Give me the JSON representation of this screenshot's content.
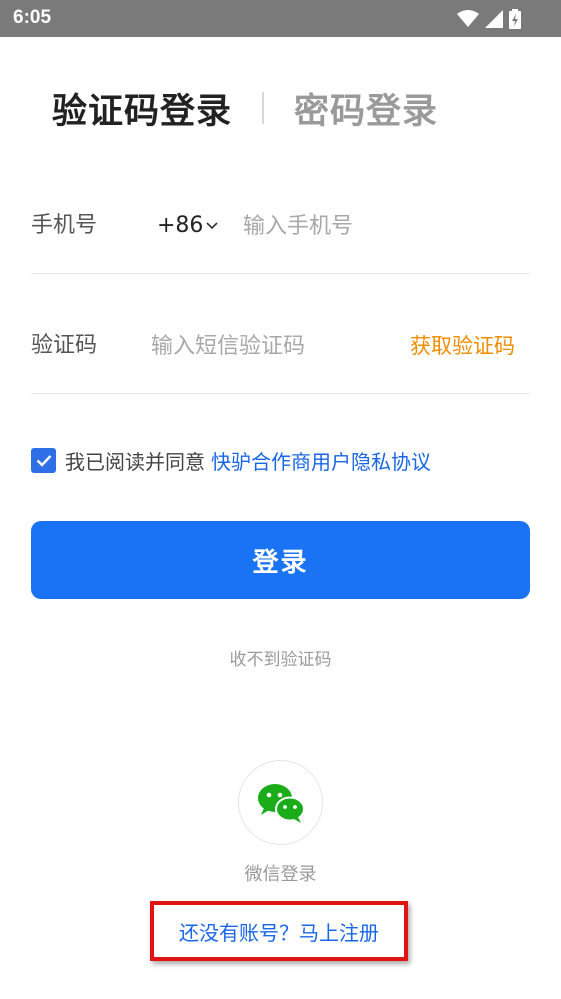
{
  "status_bar": {
    "time": "6:05",
    "icons": [
      "wifi-icon",
      "signal-icon",
      "battery-charging-icon"
    ]
  },
  "tabs": {
    "active": "验证码登录",
    "inactive": "密码登录"
  },
  "phone": {
    "label": "手机号",
    "country_code": "+86",
    "placeholder": "输入手机号",
    "value": ""
  },
  "code": {
    "label": "验证码",
    "placeholder": "输入短信验证码",
    "value": "",
    "get_code": "获取验证码"
  },
  "agreement": {
    "checked": true,
    "text": "我已阅读并同意",
    "link": "快驴合作商用户隐私协议"
  },
  "login_button": "登录",
  "no_code": "收不到验证码",
  "wechat": {
    "label": "微信登录",
    "icon": "wechat-icon"
  },
  "register": "还没有账号？马上注册",
  "colors": {
    "primary": "#1a73f5",
    "link": "#1a66e8",
    "accent": "#f08c00",
    "highlight_box": "#e11414",
    "wechat_green": "#1aad19"
  }
}
